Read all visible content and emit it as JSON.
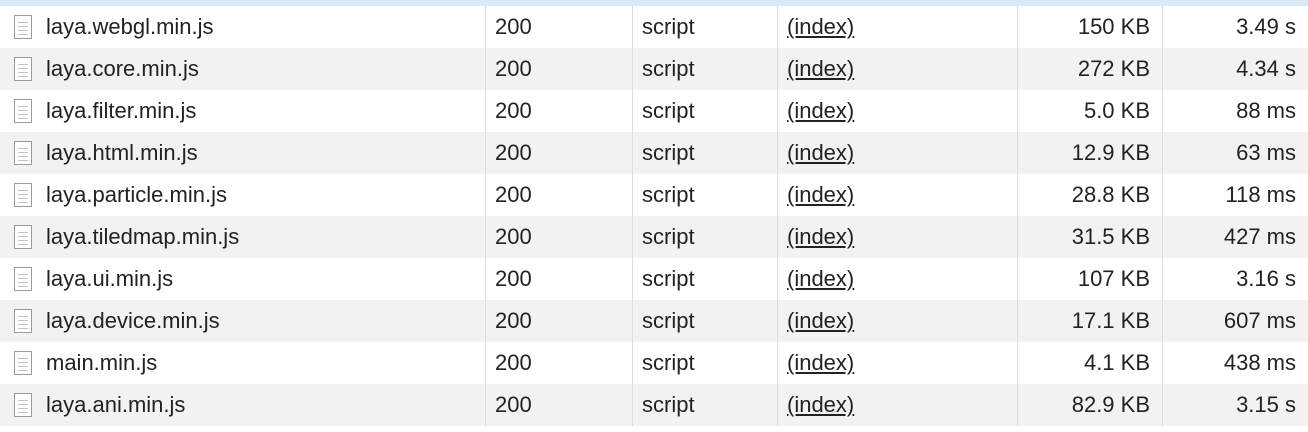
{
  "requests": [
    {
      "name": "laya.webgl.min.js",
      "status": "200",
      "type": "script",
      "initiator": "(index)",
      "size": "150 KB",
      "time": "3.49 s"
    },
    {
      "name": "laya.core.min.js",
      "status": "200",
      "type": "script",
      "initiator": "(index)",
      "size": "272 KB",
      "time": "4.34 s"
    },
    {
      "name": "laya.filter.min.js",
      "status": "200",
      "type": "script",
      "initiator": "(index)",
      "size": "5.0 KB",
      "time": "88 ms"
    },
    {
      "name": "laya.html.min.js",
      "status": "200",
      "type": "script",
      "initiator": "(index)",
      "size": "12.9 KB",
      "time": "63 ms"
    },
    {
      "name": "laya.particle.min.js",
      "status": "200",
      "type": "script",
      "initiator": "(index)",
      "size": "28.8 KB",
      "time": "118 ms"
    },
    {
      "name": "laya.tiledmap.min.js",
      "status": "200",
      "type": "script",
      "initiator": "(index)",
      "size": "31.5 KB",
      "time": "427 ms"
    },
    {
      "name": "laya.ui.min.js",
      "status": "200",
      "type": "script",
      "initiator": "(index)",
      "size": "107 KB",
      "time": "3.16 s"
    },
    {
      "name": "laya.device.min.js",
      "status": "200",
      "type": "script",
      "initiator": "(index)",
      "size": "17.1 KB",
      "time": "607 ms"
    },
    {
      "name": "main.min.js",
      "status": "200",
      "type": "script",
      "initiator": "(index)",
      "size": "4.1 KB",
      "time": "438 ms"
    },
    {
      "name": "laya.ani.min.js",
      "status": "200",
      "type": "script",
      "initiator": "(index)",
      "size": "82.9 KB",
      "time": "3.15 s"
    }
  ],
  "icons": {
    "file": "document-icon"
  },
  "colors": {
    "row_alt": "#f2f2f2",
    "header_strip": "#d9e9f7",
    "text": "#222222"
  }
}
